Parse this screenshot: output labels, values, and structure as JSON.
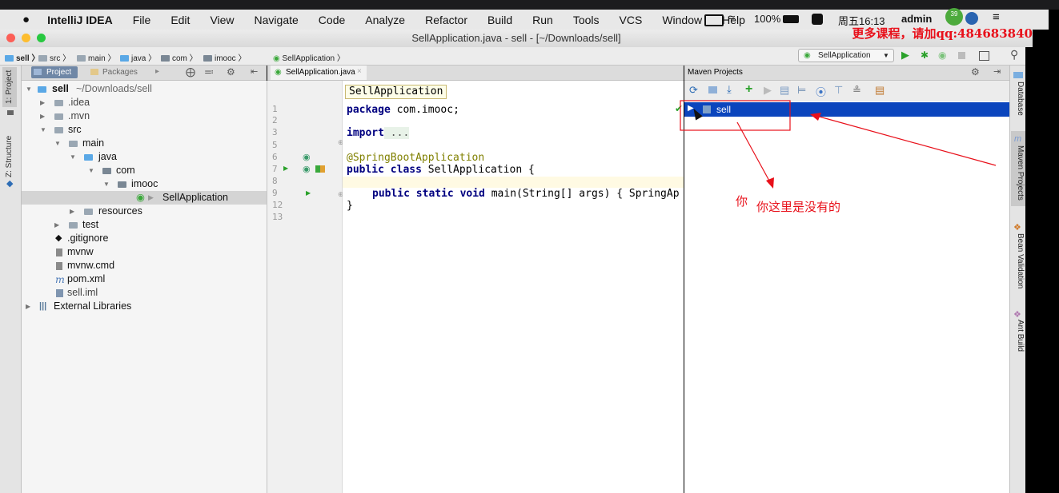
{
  "menubar": {
    "app": "IntelliJ IDEA",
    "items": [
      "File",
      "Edit",
      "View",
      "Navigate",
      "Code",
      "Analyze",
      "Refactor",
      "Build",
      "Run",
      "Tools",
      "VCS",
      "Window",
      "Help"
    ],
    "battery": "100%",
    "clock": "周五16:13",
    "user": "admin",
    "badge": "39"
  },
  "window": {
    "title": "SellApplication.java - sell - [~/Downloads/sell]",
    "promo": "更多课程，请加qq:484683840"
  },
  "breadcrumb": [
    "sell",
    "src",
    "main",
    "java",
    "com",
    "imooc",
    "SellApplication"
  ],
  "run_config": "SellApplication",
  "left_tabs": {
    "project": "1: Project",
    "structure": "Z: Structure"
  },
  "project_panel": {
    "tab_project": "Project",
    "tab_packages": "Packages",
    "tree": [
      {
        "label": "sell",
        "extra": "~/Downloads/sell",
        "depth": 0,
        "expanded": true,
        "bold": true
      },
      {
        "label": ".idea",
        "depth": 1,
        "expanded": false
      },
      {
        "label": ".mvn",
        "depth": 1,
        "expanded": false
      },
      {
        "label": "src",
        "depth": 1,
        "expanded": true
      },
      {
        "label": "main",
        "depth": 2,
        "expanded": true
      },
      {
        "label": "java",
        "depth": 3,
        "expanded": true
      },
      {
        "label": "com",
        "depth": 4,
        "expanded": true
      },
      {
        "label": "imooc",
        "depth": 5,
        "expanded": true
      },
      {
        "label": "SellApplication",
        "depth": 6,
        "selected": true
      },
      {
        "label": "resources",
        "depth": 3,
        "expanded": false
      },
      {
        "label": "test",
        "depth": 2,
        "expanded": false
      },
      {
        "label": ".gitignore",
        "depth": 1
      },
      {
        "label": "mvnw",
        "depth": 1
      },
      {
        "label": "mvnw.cmd",
        "depth": 1
      },
      {
        "label": "pom.xml",
        "depth": 1
      },
      {
        "label": "sell.iml",
        "depth": 1
      },
      {
        "label": "External Libraries",
        "depth": 0,
        "expanded": false
      }
    ]
  },
  "editor": {
    "tab": "SellApplication.java",
    "class_tooltip": "SellApplication",
    "line_numbers": [
      "1",
      "2",
      "3",
      "5",
      "6",
      "7",
      "8",
      "9",
      "12",
      "13"
    ],
    "lines": {
      "l1_kw": "package",
      "l1_rest": " com.imooc;",
      "l3_kw": "import",
      "l3_rest": " ...",
      "l6": "@SpringBootApplication",
      "l7_kw": "public class",
      "l7_rest": " SellApplication {",
      "l9_kw": "public static void",
      "l9_rest": " main(String[] args) { SpringAp",
      "l12": "}"
    }
  },
  "maven": {
    "title": "Maven Projects",
    "root": "sell"
  },
  "right_tabs": [
    "Database",
    "Maven Projects",
    "Bean Validation",
    "Ant Build"
  ],
  "annotation": {
    "char": "你",
    "text": "你这里是没有的",
    "color": "#e8101a"
  }
}
